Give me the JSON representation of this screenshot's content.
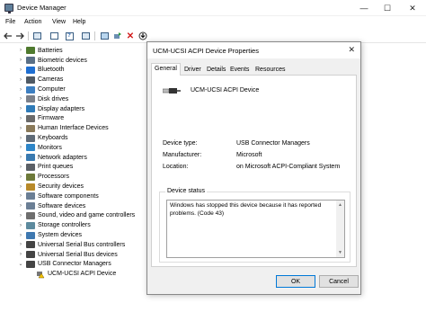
{
  "window": {
    "title": "Device Manager",
    "minimize": "—",
    "maximize": "☐",
    "close": "✕"
  },
  "menu": [
    "File",
    "Action",
    "View",
    "Help"
  ],
  "tree": {
    "items": [
      {
        "label": "Batteries",
        "color": "#4f7a2e"
      },
      {
        "label": "Biometric devices",
        "color": "#5a6f86"
      },
      {
        "label": "Bluetooth",
        "color": "#1f6fd1"
      },
      {
        "label": "Cameras",
        "color": "#505a64"
      },
      {
        "label": "Computer",
        "color": "#3d7fc1"
      },
      {
        "label": "Disk drives",
        "color": "#7b8089"
      },
      {
        "label": "Display adapters",
        "color": "#2f7bb8"
      },
      {
        "label": "Firmware",
        "color": "#6a6a6a"
      },
      {
        "label": "Human Interface Devices",
        "color": "#8a7a5a"
      },
      {
        "label": "Keyboards",
        "color": "#5f6b78"
      },
      {
        "label": "Monitors",
        "color": "#2e86c8"
      },
      {
        "label": "Network adapters",
        "color": "#3a7ab0"
      },
      {
        "label": "Print queues",
        "color": "#5b6066"
      },
      {
        "label": "Processors",
        "color": "#6e7a3a"
      },
      {
        "label": "Security devices",
        "color": "#b88a2a"
      },
      {
        "label": "Software components",
        "color": "#6b7f95"
      },
      {
        "label": "Software devices",
        "color": "#6b7f95"
      },
      {
        "label": "Sound, video and game controllers",
        "color": "#6e6e6e"
      },
      {
        "label": "Storage controllers",
        "color": "#5d8a9e"
      },
      {
        "label": "System devices",
        "color": "#3f78b0"
      },
      {
        "label": "Universal Serial Bus controllers",
        "color": "#444444"
      },
      {
        "label": "Universal Serial Bus devices",
        "color": "#444444"
      },
      {
        "label": "USB Connector Managers",
        "color": "#444444",
        "expanded": true
      },
      {
        "label": "UCM-UCSI ACPI Device",
        "color": "#c08a20",
        "child": true,
        "warning": true
      }
    ]
  },
  "dialog": {
    "title": "UCM-UCSI ACPI Device Properties",
    "close": "✕",
    "tabs": [
      "General",
      "Driver",
      "Details",
      "Events",
      "Resources"
    ],
    "active_tab": "General",
    "device_name": "UCM-UCSI ACPI Device",
    "properties": [
      {
        "label": "Device type:",
        "value": "USB Connector Managers"
      },
      {
        "label": "Manufacturer:",
        "value": "Microsoft"
      },
      {
        "label": "Location:",
        "value": "on Microsoft ACPI-Compliant System"
      }
    ],
    "status_label": "Device status",
    "status_text": "Windows has stopped this device because it has reported problems. (Code 43)",
    "ok_label": "OK",
    "cancel_label": "Cancel"
  }
}
